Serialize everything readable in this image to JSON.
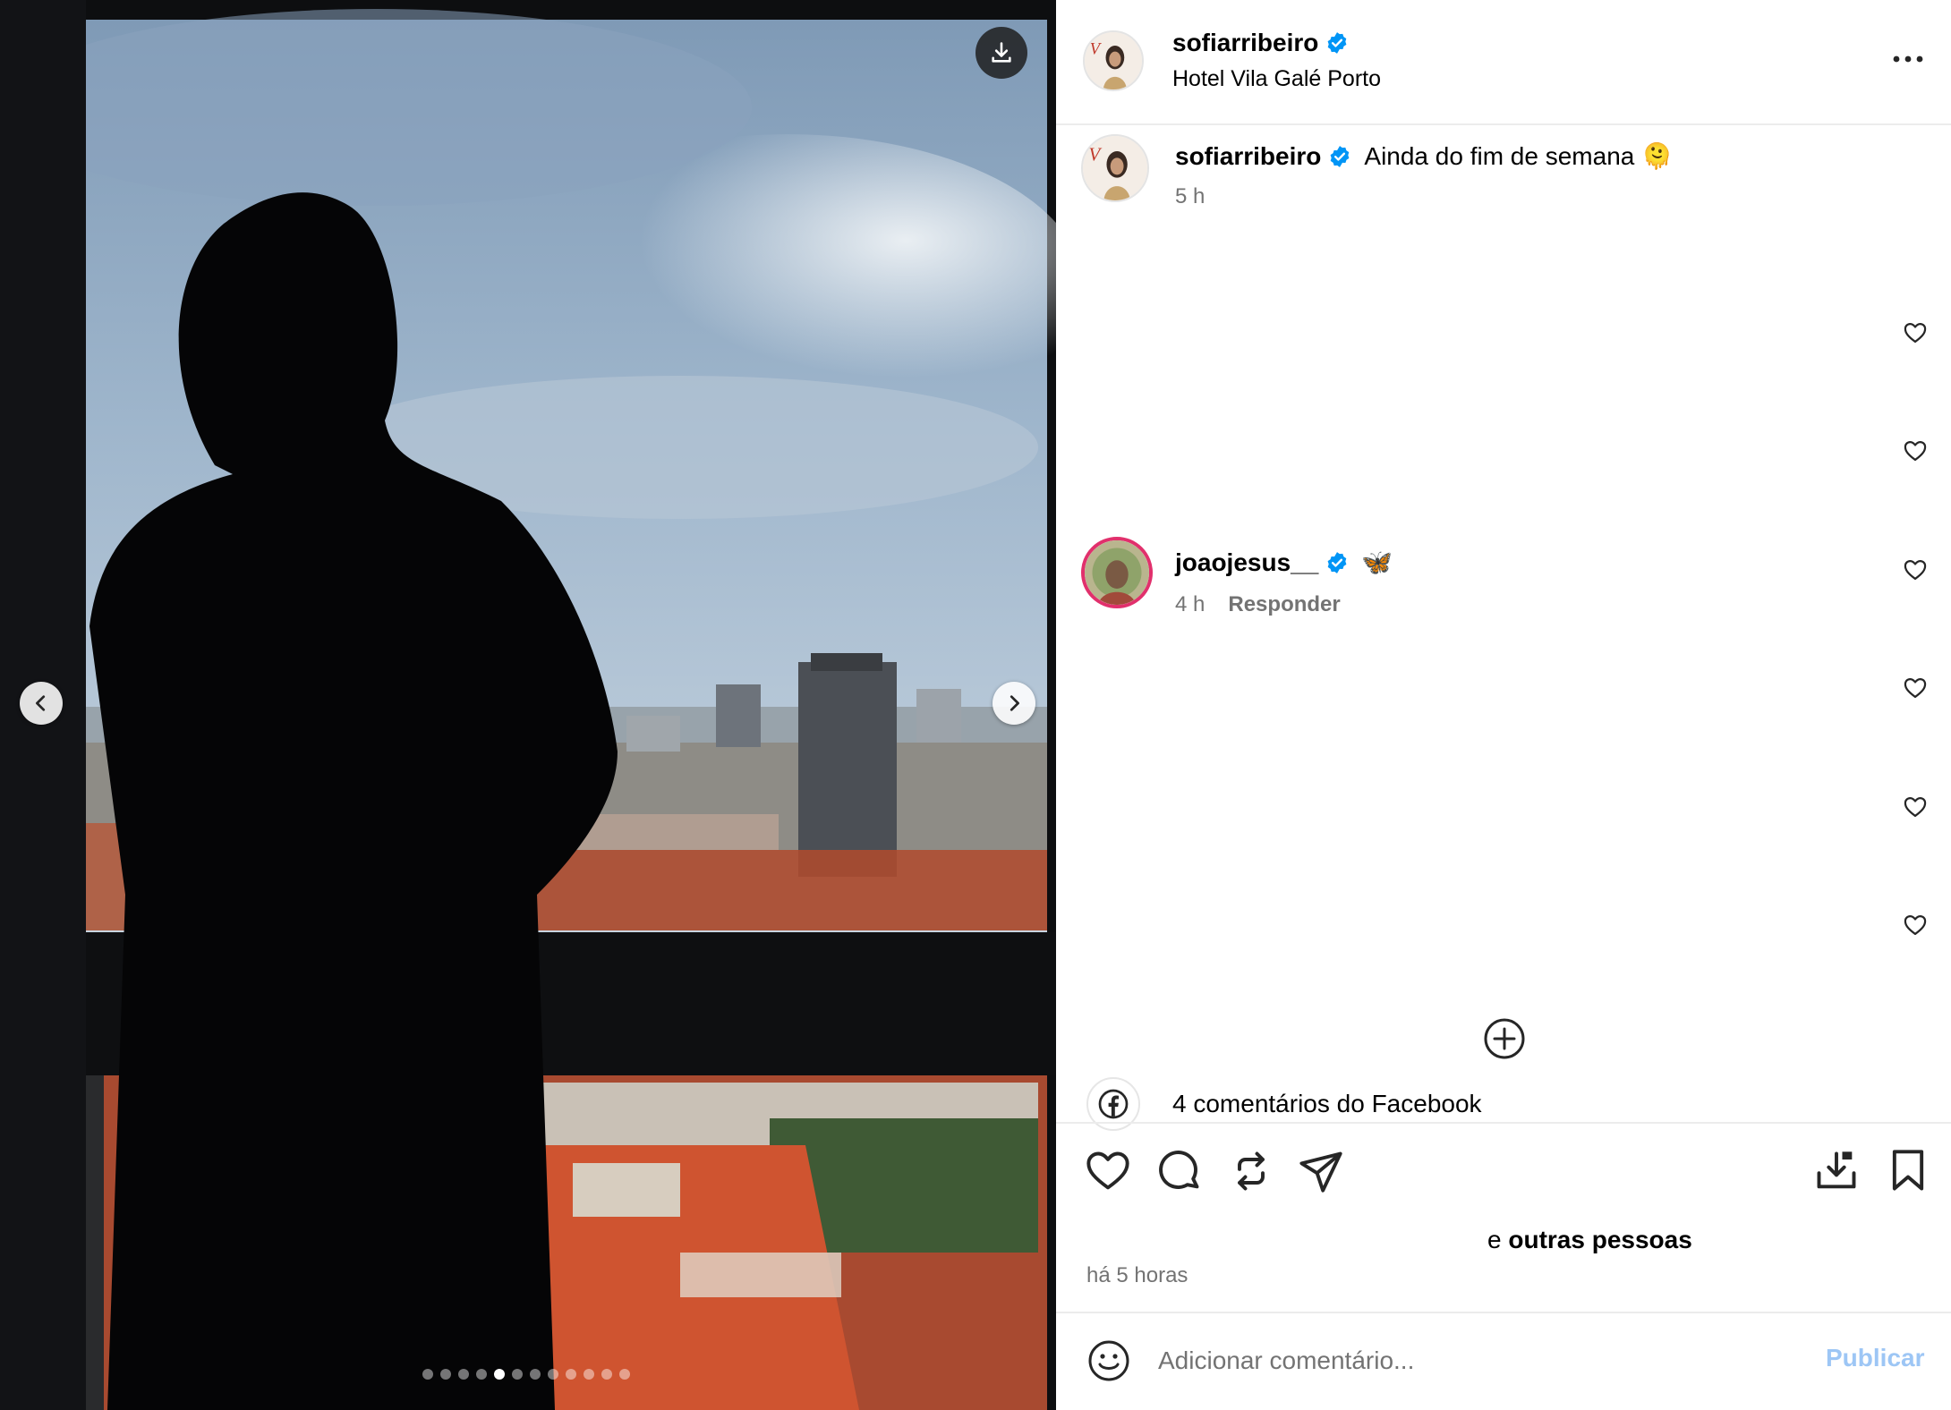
{
  "media": {
    "carousel_count": 12,
    "active_index": 4,
    "download_icon": "download-icon",
    "prev_icon": "chevron-left-icon",
    "next_icon": "chevron-right-icon"
  },
  "header": {
    "username": "sofiarribeiro",
    "verified": true,
    "location": "Hotel Vila Galé Porto",
    "more_icon": "more-horizontal-icon"
  },
  "caption": {
    "username": "sofiarribeiro",
    "text": "Ainda do fim de semana 🫠",
    "time": "5 h"
  },
  "comments": [
    {
      "username": "joaojesus__",
      "text": "🦋",
      "time": "4 h",
      "reply_label": "Responder"
    }
  ],
  "comment_like_icon": "heart-outline-icon",
  "load_more_icon": "plus-circle-icon",
  "facebook": {
    "icon": "facebook-icon",
    "label": "4 comentários do Facebook"
  },
  "actions": {
    "like": "heart-icon",
    "comment": "comment-icon",
    "repost": "repost-icon",
    "share": "send-icon",
    "save_download": "download-tray-icon",
    "bookmark": "bookmark-icon"
  },
  "likes": {
    "prefix": "e ",
    "others": "outras pessoas"
  },
  "posted_time": "há 5 horas",
  "add_comment": {
    "emoji_icon": "emoji-icon",
    "placeholder": "Adicionar comentário...",
    "publish_label": "Publicar"
  },
  "colors": {
    "verified": "#0095f6",
    "publish_disabled": "#9dc6f5",
    "muted_text": "#737373",
    "roof_accent": "#d9532e"
  }
}
